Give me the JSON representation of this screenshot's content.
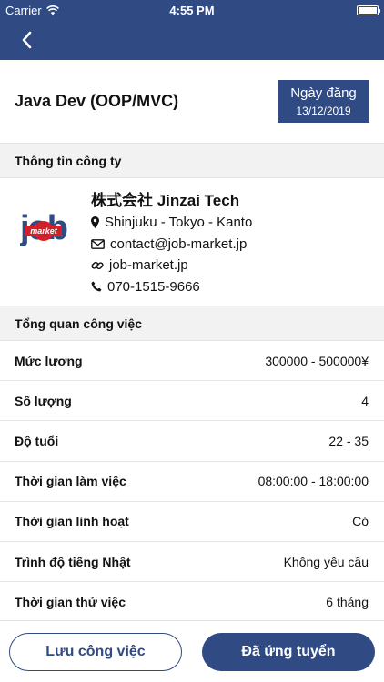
{
  "status_bar": {
    "carrier": "Carrier",
    "time": "4:55 PM"
  },
  "job": {
    "title": "Java Dev (OOP/MVC)",
    "date_label": "Ngày đăng",
    "date_value": "13/12/2019"
  },
  "company_section": {
    "header": "Thông tin công ty",
    "logo_text": "job",
    "logo_subtext": "market",
    "name": "株式会社 Jinzai Tech",
    "location": "Shinjuku - Tokyo - Kanto",
    "email": "contact@job-market.jp",
    "website": "job-market.jp",
    "phone": "070-1515-9666"
  },
  "overview": {
    "header": "Tổng quan công việc",
    "rows": [
      {
        "label": "Mức lương",
        "value": "300000 - 500000¥"
      },
      {
        "label": "Số lượng",
        "value": "4"
      },
      {
        "label": "Độ tuổi",
        "value": "22 - 35"
      },
      {
        "label": "Thời gian làm việc",
        "value": "08:00:00 - 18:00:00"
      },
      {
        "label": "Thời gian linh hoạt",
        "value": "Có"
      },
      {
        "label": "Trình độ tiếng Nhật",
        "value": "Không yêu cầu"
      },
      {
        "label": "Thời gian thử việc",
        "value": "6 tháng"
      }
    ]
  },
  "actions": {
    "save_label": "Lưu công việc",
    "applied_label": "Đã ứng tuyển"
  },
  "colors": {
    "primary": "#304a84",
    "logo_red": "#d0202a"
  },
  "icons": [
    "wifi-icon",
    "battery-icon",
    "back-chevron-icon",
    "map-marker-icon",
    "envelope-icon",
    "link-icon",
    "phone-icon"
  ]
}
